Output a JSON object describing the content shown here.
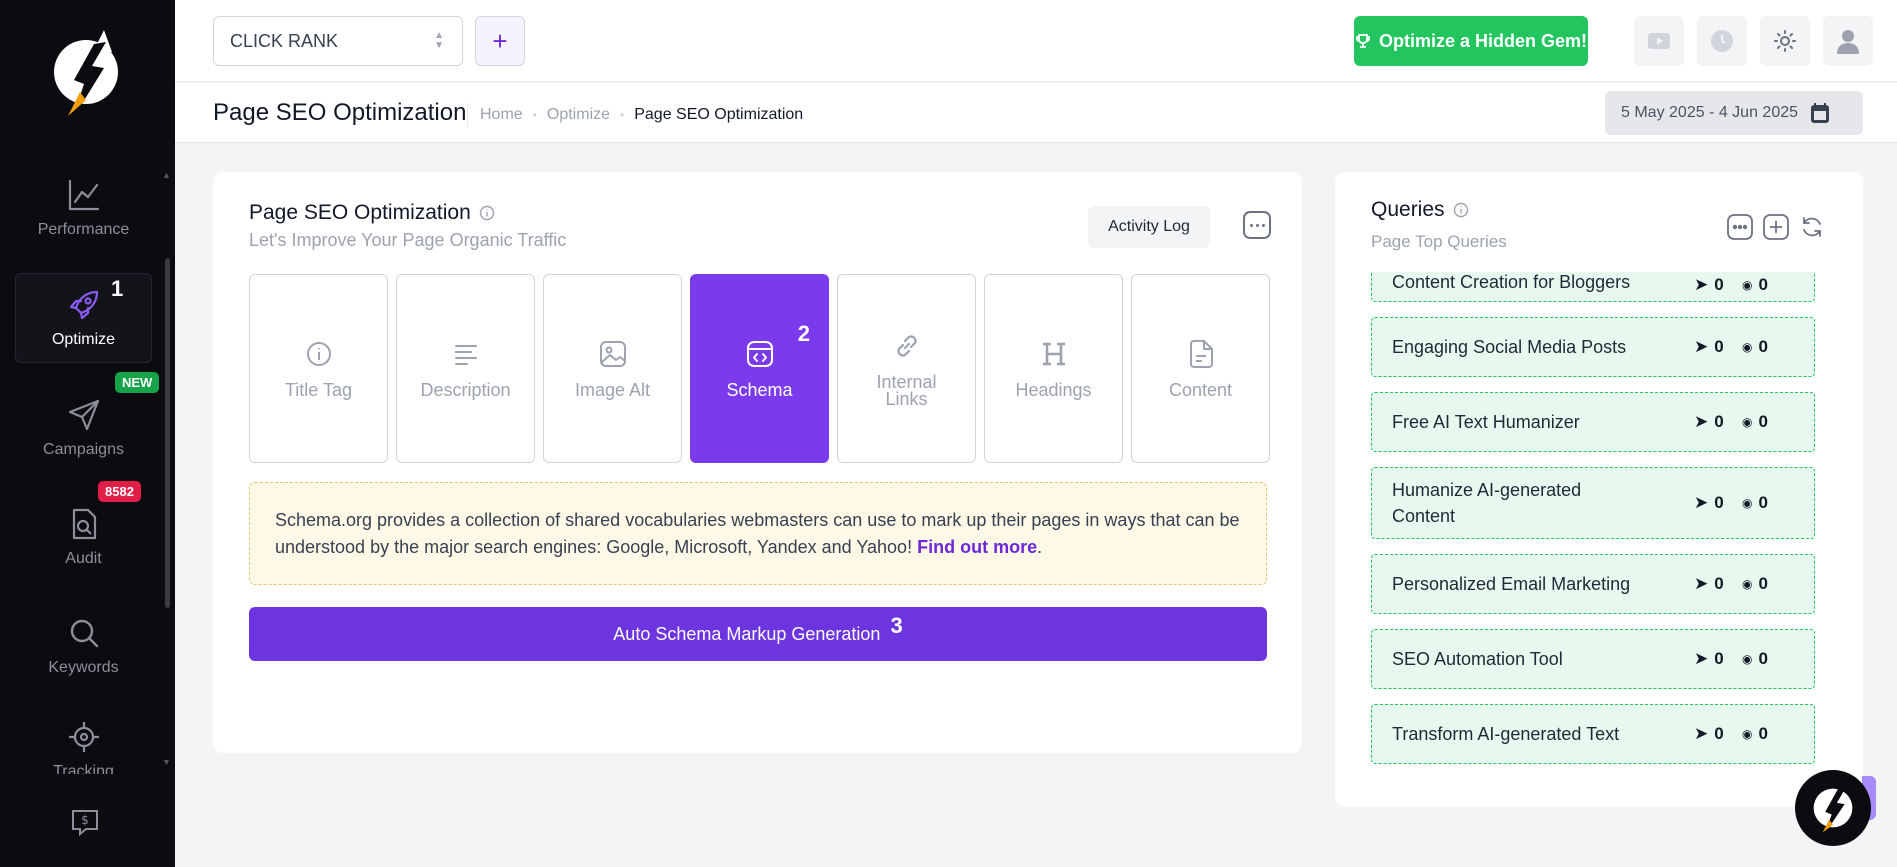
{
  "sidebar": {
    "items": [
      {
        "label": "Performance"
      },
      {
        "label": "Optimize",
        "step": "1"
      },
      {
        "label": "Campaigns",
        "badge": "NEW"
      },
      {
        "label": "Audit",
        "badge": "8582"
      },
      {
        "label": "Keywords"
      },
      {
        "label": "Tracking"
      }
    ]
  },
  "topbar": {
    "project": "CLICK RANK",
    "add_label": "+",
    "gem_label": "Optimize a Hidden Gem!"
  },
  "titlebar": {
    "title": "Page SEO Optimization",
    "breadcrumb": [
      "Home",
      "Optimize",
      "Page SEO Optimization"
    ],
    "date_range": "5 May 2025 - 4 Jun 2025"
  },
  "main": {
    "title": "Page SEO Optimization",
    "subtitle": "Let's Improve Your Page Organic Traffic",
    "activity_label": "Activity Log",
    "tabs": [
      {
        "label": "Title Tag",
        "icon": "info-icon"
      },
      {
        "label": "Description",
        "icon": "lines-icon"
      },
      {
        "label": "Image Alt",
        "icon": "image-icon"
      },
      {
        "label": "Schema",
        "icon": "schema-icon",
        "active": true,
        "step": "2"
      },
      {
        "label": "Internal Links",
        "icon": "link-icon"
      },
      {
        "label": "Headings",
        "icon": "heading-icon"
      },
      {
        "label": "Content",
        "icon": "document-icon"
      }
    ],
    "info_text": "Schema.org provides a collection of shared vocabularies webmasters can use to mark up their pages in ways that can be understood by the major search engines: Google, Microsoft, Yandex and Yahoo!",
    "info_link": "Find out more",
    "info_end": ".",
    "generate_label": "Auto Schema Markup Generation",
    "generate_step": "3"
  },
  "queries": {
    "title": "Queries",
    "subtitle": "Page Top Queries",
    "rows": [
      {
        "name": "Content Creation for Bloggers",
        "clicks": "0",
        "impressions": "0"
      },
      {
        "name": "Engaging Social Media Posts",
        "clicks": "0",
        "impressions": "0"
      },
      {
        "name": "Free AI Text Humanizer",
        "clicks": "0",
        "impressions": "0"
      },
      {
        "name": "Humanize AI-generated Content",
        "clicks": "0",
        "impressions": "0"
      },
      {
        "name": "Personalized Email Marketing",
        "clicks": "0",
        "impressions": "0"
      },
      {
        "name": "SEO Automation Tool",
        "clicks": "0",
        "impressions": "0"
      },
      {
        "name": "Transform AI-generated Text",
        "clicks": "0",
        "impressions": "0"
      }
    ]
  },
  "colors": {
    "sidebar_bg": "#0b0b10",
    "accent": "#7c3aed",
    "success": "#22c55e",
    "danger": "#e11d48"
  }
}
